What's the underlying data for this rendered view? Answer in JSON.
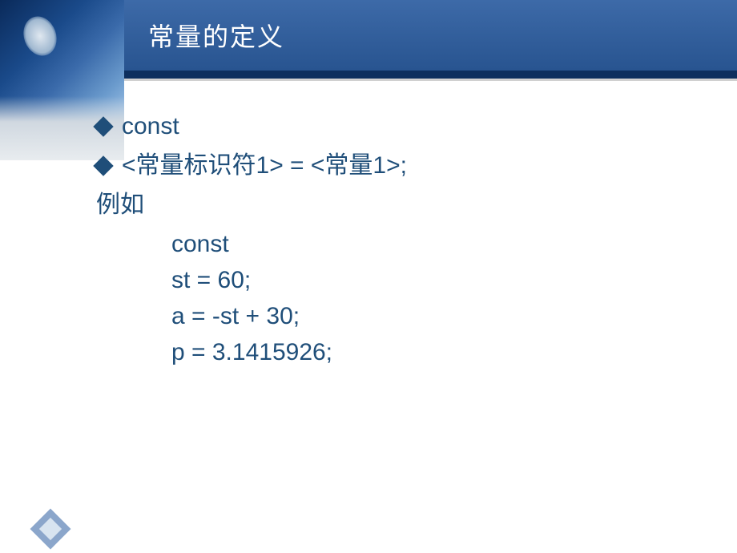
{
  "title": "常量的定义",
  "bullets": [
    "const",
    "<常量标识符1> = <常量1>;"
  ],
  "example_label": "例如",
  "code_lines": [
    "const",
    "st = 60;",
    "a = -st + 30;",
    "p = 3.1415926;"
  ]
}
